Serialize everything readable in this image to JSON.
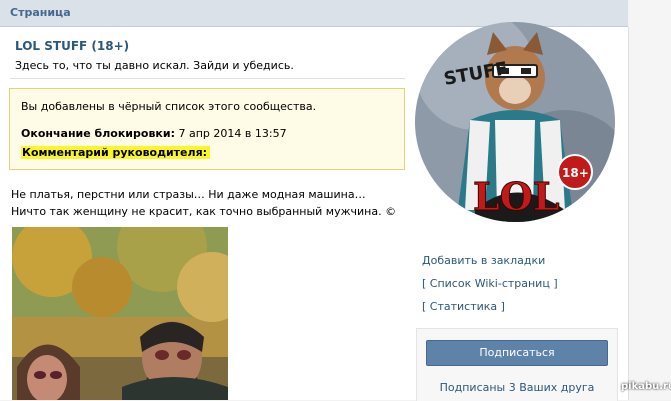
{
  "header": {
    "title": "Страница"
  },
  "group": {
    "name": "LOL STUFF (18+)",
    "description": "Здесь то, что ты давно искал. Зайди и убедись."
  },
  "ban_notice": {
    "message": "Вы добавлены в чёрный список этого сообщества.",
    "end_label": "Окончание блокировки:",
    "end_value": "7 апр 2014 в 13:57",
    "comment_label": "Комментарий руководителя:",
    "comment_value": ""
  },
  "post": {
    "text": "Не платья, перстни или стразы… Ни даже модная машина… Ничто так женщину не красит, как точно выбранный мужчина. ©"
  },
  "avatar": {
    "side_text": "STUFF",
    "logo_text": "LOL",
    "badge_text": "18+"
  },
  "sidebar": {
    "links": [
      "Добавить в закладки",
      "[ Список Wiki-страниц ]",
      "[ Статистика ]"
    ],
    "subscribe_label": "Подписаться",
    "friends_text": "Подписаны 3 Ваших друга"
  },
  "watermark": "pikabu.ru",
  "colors": {
    "link": "#2b587a",
    "header_bg": "#dae1e8",
    "button": "#5e82a8",
    "highlight": "#fbf62c"
  }
}
